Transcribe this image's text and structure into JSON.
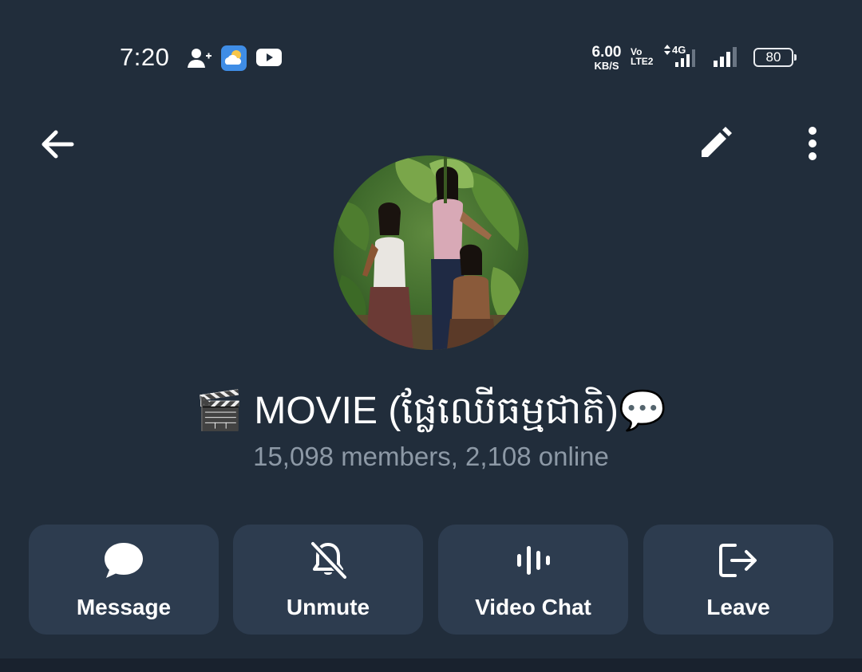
{
  "status_bar": {
    "time": "7:20",
    "icons": [
      "add-contact-icon",
      "weather-icon",
      "youtube-icon"
    ],
    "net_speed_value": "6.00",
    "net_speed_unit": "KB/S",
    "volte_top": "Vo",
    "volte_bottom": "LTE2",
    "network_type": "4G",
    "battery": "80"
  },
  "header": {
    "back_icon": "arrow-left-icon",
    "edit_icon": "pencil-icon",
    "more_icon": "more-vertical-icon"
  },
  "profile": {
    "title_emoji_left": "🎬",
    "title_text": "MOVIE (ផ្លែឈើធម្មជាតិ)",
    "title_emoji_right": "💬",
    "members": "15,098 members, 2,108 online"
  },
  "actions": [
    {
      "label": "Message",
      "icon": "chat-bubble-icon"
    },
    {
      "label": "Unmute",
      "icon": "bell-off-icon"
    },
    {
      "label": "Video Chat",
      "icon": "voice-bars-icon"
    },
    {
      "label": "Leave",
      "icon": "exit-icon"
    }
  ],
  "colors": {
    "background": "#212d3b",
    "button_bg": "#2d3c4f",
    "secondary_text": "#8d99a6"
  }
}
